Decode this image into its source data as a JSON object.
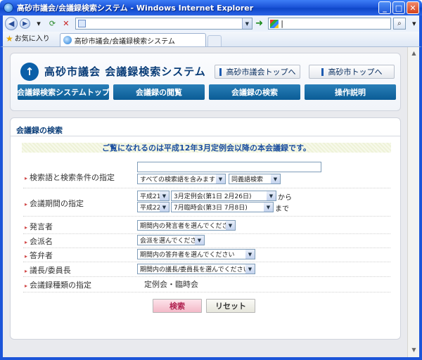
{
  "window": {
    "title": "高砂市議会/会議録検索システム - Windows Internet Explorer",
    "minimize_glyph": "_",
    "maximize_glyph": "□",
    "close_glyph": "✕"
  },
  "browser": {
    "address_value": "",
    "search_value": "|",
    "favorites_label": "お気に入り",
    "tab_title": "高砂市議会/会議録検索システム"
  },
  "header": {
    "site_title": "高砂市議会  会議録検索システム",
    "link_council_top": "高砂市議会トップへ",
    "link_city_top": "高砂市トップへ",
    "menu": [
      "会議録検索システムトップ",
      "会議録の閲覧",
      "会議録の検索",
      "操作説明"
    ]
  },
  "search_section": {
    "title": "会議録の検索",
    "notice": "ご覧になれるのは平成12年3月定例会以降の本会議録です。",
    "keyword": {
      "label": "検索語と検索条件の指定",
      "value": "",
      "mode": "すべての検索語を含みます",
      "synonym": "同義語検索"
    },
    "period": {
      "label": "会議期間の指定",
      "from_year": "平成21年",
      "from_session": "3月定例会(第1日 2月26日)",
      "from_suffix": "から",
      "to_year": "平成22年",
      "to_session": "7月臨時会(第3日 7月8日)",
      "to_suffix": "まで"
    },
    "speaker": {
      "label": "発言者",
      "value": "期間内の発言者を選んでください"
    },
    "faction": {
      "label": "会派名",
      "value": "会派を選んでください"
    },
    "respondent": {
      "label": "答弁者",
      "value": "期間内の答弁者を選んでください"
    },
    "chair": {
      "label": "議長/委員長",
      "value": "期間内の議長/委員長を選んでください"
    },
    "record_type": {
      "label": "会議録種類の指定",
      "value": "定例会・臨時会"
    },
    "search_button": "検索",
    "reset_button": "リセット"
  },
  "colors": {
    "accent": "#0a5c96",
    "title_text": "#0a3d78",
    "search_button": "#b02050"
  }
}
